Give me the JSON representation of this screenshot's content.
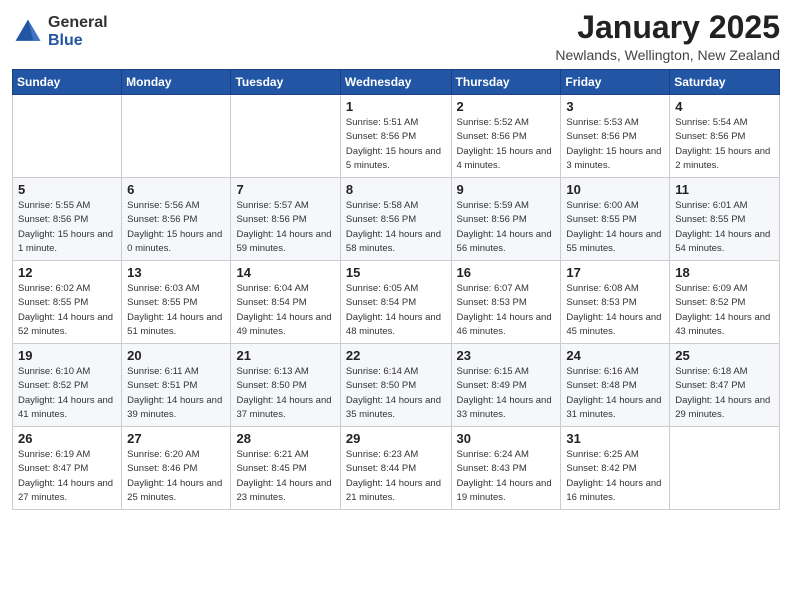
{
  "logo": {
    "general": "General",
    "blue": "Blue"
  },
  "title": "January 2025",
  "subtitle": "Newlands, Wellington, New Zealand",
  "days_of_week": [
    "Sunday",
    "Monday",
    "Tuesday",
    "Wednesday",
    "Thursday",
    "Friday",
    "Saturday"
  ],
  "weeks": [
    [
      {
        "day": "",
        "sunrise": "",
        "sunset": "",
        "daylight": ""
      },
      {
        "day": "",
        "sunrise": "",
        "sunset": "",
        "daylight": ""
      },
      {
        "day": "",
        "sunrise": "",
        "sunset": "",
        "daylight": ""
      },
      {
        "day": "1",
        "sunrise": "Sunrise: 5:51 AM",
        "sunset": "Sunset: 8:56 PM",
        "daylight": "Daylight: 15 hours and 5 minutes."
      },
      {
        "day": "2",
        "sunrise": "Sunrise: 5:52 AM",
        "sunset": "Sunset: 8:56 PM",
        "daylight": "Daylight: 15 hours and 4 minutes."
      },
      {
        "day": "3",
        "sunrise": "Sunrise: 5:53 AM",
        "sunset": "Sunset: 8:56 PM",
        "daylight": "Daylight: 15 hours and 3 minutes."
      },
      {
        "day": "4",
        "sunrise": "Sunrise: 5:54 AM",
        "sunset": "Sunset: 8:56 PM",
        "daylight": "Daylight: 15 hours and 2 minutes."
      }
    ],
    [
      {
        "day": "5",
        "sunrise": "Sunrise: 5:55 AM",
        "sunset": "Sunset: 8:56 PM",
        "daylight": "Daylight: 15 hours and 1 minute."
      },
      {
        "day": "6",
        "sunrise": "Sunrise: 5:56 AM",
        "sunset": "Sunset: 8:56 PM",
        "daylight": "Daylight: 15 hours and 0 minutes."
      },
      {
        "day": "7",
        "sunrise": "Sunrise: 5:57 AM",
        "sunset": "Sunset: 8:56 PM",
        "daylight": "Daylight: 14 hours and 59 minutes."
      },
      {
        "day": "8",
        "sunrise": "Sunrise: 5:58 AM",
        "sunset": "Sunset: 8:56 PM",
        "daylight": "Daylight: 14 hours and 58 minutes."
      },
      {
        "day": "9",
        "sunrise": "Sunrise: 5:59 AM",
        "sunset": "Sunset: 8:56 PM",
        "daylight": "Daylight: 14 hours and 56 minutes."
      },
      {
        "day": "10",
        "sunrise": "Sunrise: 6:00 AM",
        "sunset": "Sunset: 8:55 PM",
        "daylight": "Daylight: 14 hours and 55 minutes."
      },
      {
        "day": "11",
        "sunrise": "Sunrise: 6:01 AM",
        "sunset": "Sunset: 8:55 PM",
        "daylight": "Daylight: 14 hours and 54 minutes."
      }
    ],
    [
      {
        "day": "12",
        "sunrise": "Sunrise: 6:02 AM",
        "sunset": "Sunset: 8:55 PM",
        "daylight": "Daylight: 14 hours and 52 minutes."
      },
      {
        "day": "13",
        "sunrise": "Sunrise: 6:03 AM",
        "sunset": "Sunset: 8:55 PM",
        "daylight": "Daylight: 14 hours and 51 minutes."
      },
      {
        "day": "14",
        "sunrise": "Sunrise: 6:04 AM",
        "sunset": "Sunset: 8:54 PM",
        "daylight": "Daylight: 14 hours and 49 minutes."
      },
      {
        "day": "15",
        "sunrise": "Sunrise: 6:05 AM",
        "sunset": "Sunset: 8:54 PM",
        "daylight": "Daylight: 14 hours and 48 minutes."
      },
      {
        "day": "16",
        "sunrise": "Sunrise: 6:07 AM",
        "sunset": "Sunset: 8:53 PM",
        "daylight": "Daylight: 14 hours and 46 minutes."
      },
      {
        "day": "17",
        "sunrise": "Sunrise: 6:08 AM",
        "sunset": "Sunset: 8:53 PM",
        "daylight": "Daylight: 14 hours and 45 minutes."
      },
      {
        "day": "18",
        "sunrise": "Sunrise: 6:09 AM",
        "sunset": "Sunset: 8:52 PM",
        "daylight": "Daylight: 14 hours and 43 minutes."
      }
    ],
    [
      {
        "day": "19",
        "sunrise": "Sunrise: 6:10 AM",
        "sunset": "Sunset: 8:52 PM",
        "daylight": "Daylight: 14 hours and 41 minutes."
      },
      {
        "day": "20",
        "sunrise": "Sunrise: 6:11 AM",
        "sunset": "Sunset: 8:51 PM",
        "daylight": "Daylight: 14 hours and 39 minutes."
      },
      {
        "day": "21",
        "sunrise": "Sunrise: 6:13 AM",
        "sunset": "Sunset: 8:50 PM",
        "daylight": "Daylight: 14 hours and 37 minutes."
      },
      {
        "day": "22",
        "sunrise": "Sunrise: 6:14 AM",
        "sunset": "Sunset: 8:50 PM",
        "daylight": "Daylight: 14 hours and 35 minutes."
      },
      {
        "day": "23",
        "sunrise": "Sunrise: 6:15 AM",
        "sunset": "Sunset: 8:49 PM",
        "daylight": "Daylight: 14 hours and 33 minutes."
      },
      {
        "day": "24",
        "sunrise": "Sunrise: 6:16 AM",
        "sunset": "Sunset: 8:48 PM",
        "daylight": "Daylight: 14 hours and 31 minutes."
      },
      {
        "day": "25",
        "sunrise": "Sunrise: 6:18 AM",
        "sunset": "Sunset: 8:47 PM",
        "daylight": "Daylight: 14 hours and 29 minutes."
      }
    ],
    [
      {
        "day": "26",
        "sunrise": "Sunrise: 6:19 AM",
        "sunset": "Sunset: 8:47 PM",
        "daylight": "Daylight: 14 hours and 27 minutes."
      },
      {
        "day": "27",
        "sunrise": "Sunrise: 6:20 AM",
        "sunset": "Sunset: 8:46 PM",
        "daylight": "Daylight: 14 hours and 25 minutes."
      },
      {
        "day": "28",
        "sunrise": "Sunrise: 6:21 AM",
        "sunset": "Sunset: 8:45 PM",
        "daylight": "Daylight: 14 hours and 23 minutes."
      },
      {
        "day": "29",
        "sunrise": "Sunrise: 6:23 AM",
        "sunset": "Sunset: 8:44 PM",
        "daylight": "Daylight: 14 hours and 21 minutes."
      },
      {
        "day": "30",
        "sunrise": "Sunrise: 6:24 AM",
        "sunset": "Sunset: 8:43 PM",
        "daylight": "Daylight: 14 hours and 19 minutes."
      },
      {
        "day": "31",
        "sunrise": "Sunrise: 6:25 AM",
        "sunset": "Sunset: 8:42 PM",
        "daylight": "Daylight: 14 hours and 16 minutes."
      },
      {
        "day": "",
        "sunrise": "",
        "sunset": "",
        "daylight": ""
      }
    ]
  ]
}
